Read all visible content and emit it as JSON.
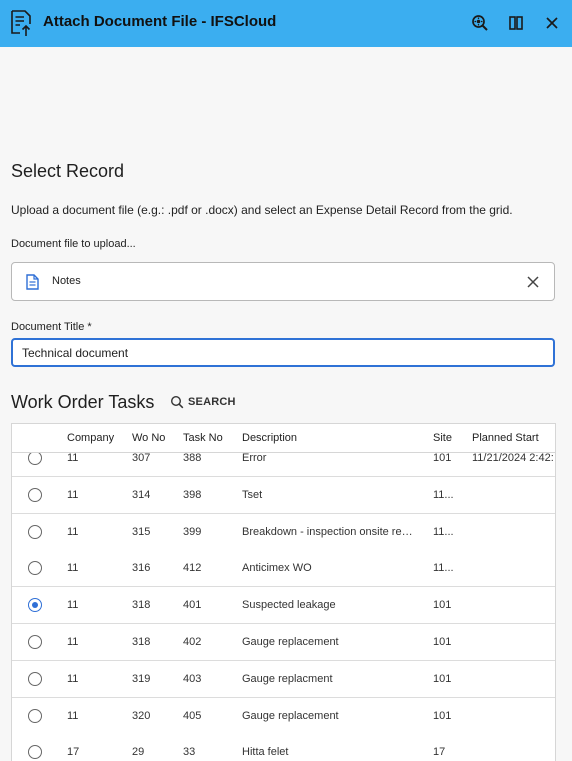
{
  "window": {
    "title": "Attach Document File - IFSCloud",
    "accent_color": "#3baef0",
    "icons": [
      "document-upload-icon",
      "zoom-search-icon",
      "split-view-icon",
      "close-icon"
    ]
  },
  "form": {
    "section_title": "Select Record",
    "description": "Upload a document file (e.g.: .pdf or .docx) and select an Expense Detail Record from the grid.",
    "file_label": "Document file to upload...",
    "file_name": "Notes",
    "doc_title_label": "Document Title *",
    "doc_title_value": "Technical document"
  },
  "grid": {
    "title": "Work Order Tasks",
    "search_label": "SEARCH",
    "columns": [
      "Company",
      "Wo No",
      "Task No",
      "Description",
      "Site",
      "Planned Start"
    ],
    "rows": [
      {
        "company": "11",
        "wo_no": "307",
        "task_no": "388",
        "description": "Error",
        "site": "101",
        "planned_start": "11/21/2024 2:42:",
        "selected": false
      },
      {
        "company": "11",
        "wo_no": "314",
        "task_no": "398",
        "description": "Tset",
        "site": "11...",
        "planned_start": "",
        "selected": false
      },
      {
        "company": "11",
        "wo_no": "315",
        "task_no": "399",
        "description": "Breakdown - inspection onsite req...",
        "site": "11...",
        "planned_start": "",
        "selected": false
      },
      {
        "company": "11",
        "wo_no": "316",
        "task_no": "412",
        "description": "Anticimex WO",
        "site": "11...",
        "planned_start": "",
        "selected": false
      },
      {
        "company": "11",
        "wo_no": "318",
        "task_no": "401",
        "description": "Suspected leakage",
        "site": "101",
        "planned_start": "",
        "selected": true
      },
      {
        "company": "11",
        "wo_no": "318",
        "task_no": "402",
        "description": "Gauge replacement",
        "site": "101",
        "planned_start": "",
        "selected": false
      },
      {
        "company": "11",
        "wo_no": "319",
        "task_no": "403",
        "description": "Gauge replacment",
        "site": "101",
        "planned_start": "",
        "selected": false
      },
      {
        "company": "11",
        "wo_no": "320",
        "task_no": "405",
        "description": "Gauge replacement",
        "site": "101",
        "planned_start": "",
        "selected": false
      },
      {
        "company": "17",
        "wo_no": "29",
        "task_no": "33",
        "description": "Hitta felet",
        "site": "17",
        "planned_start": "",
        "selected": false
      }
    ]
  }
}
